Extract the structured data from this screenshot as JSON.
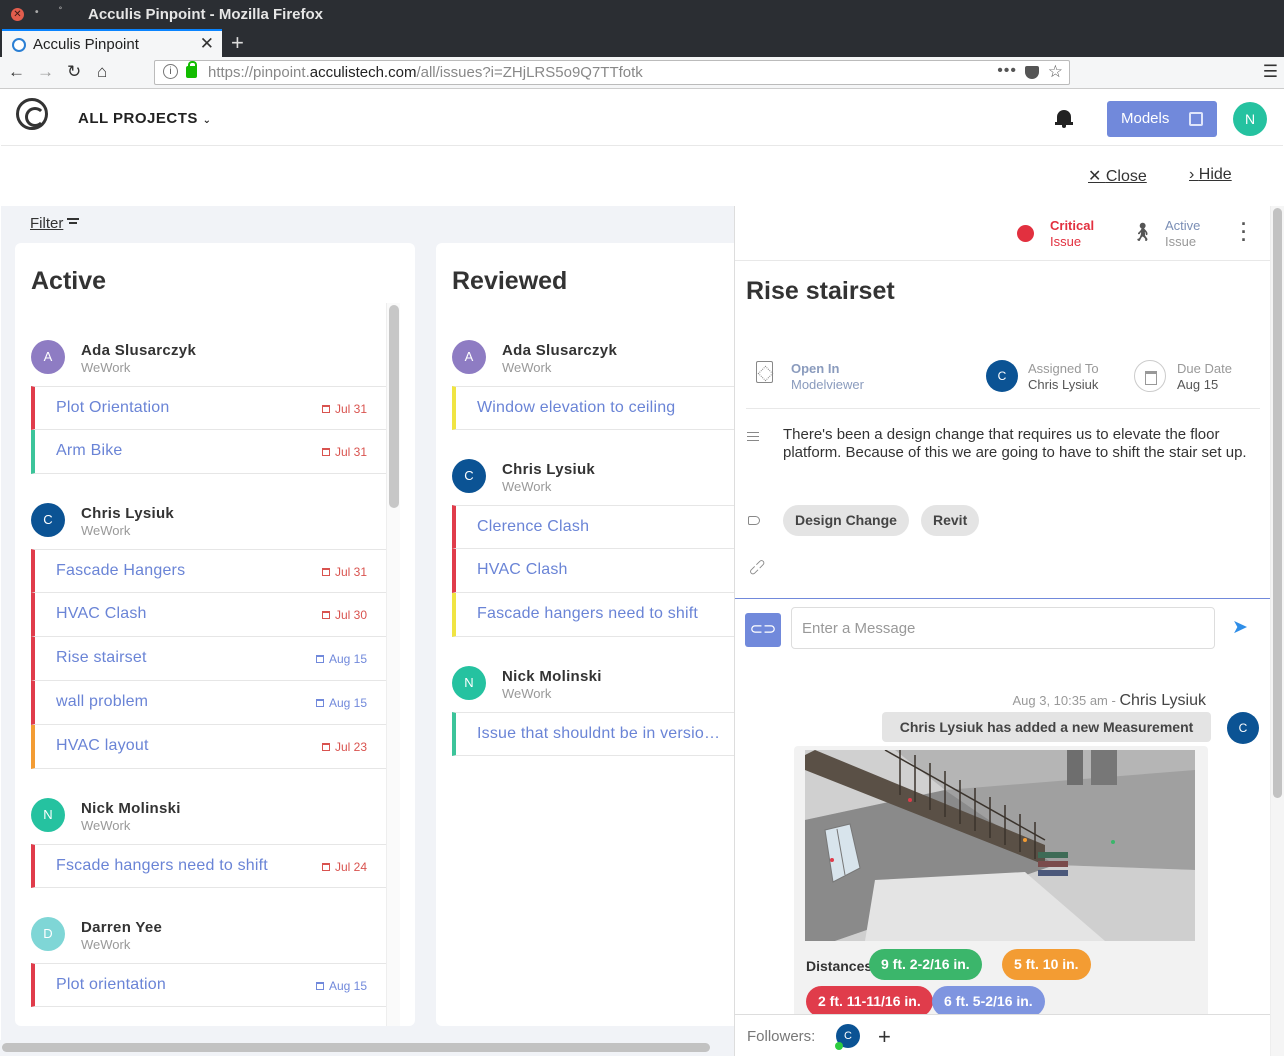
{
  "window": {
    "title": "Acculis Pinpoint - Mozilla Firefox"
  },
  "tab": {
    "title": "Acculis Pinpoint"
  },
  "address": {
    "prefix": "https://pinpoint.",
    "domain": "acculistech.com",
    "path": "/all/issues?i=ZHjLRS5o9Q7TTfotk"
  },
  "header": {
    "projects_label": "ALL PROJECTS",
    "models_label": "Models",
    "user_initial": "N"
  },
  "subheader": {
    "close_label": "Close",
    "hide_label": "Hide"
  },
  "board": {
    "filter_label": "Filter",
    "columns": [
      {
        "title": "Active",
        "groups": [
          {
            "name": "Ada Slusarczyk",
            "org": "WeWork",
            "initial": "A",
            "color": "#8e7cc3",
            "issues": [
              {
                "name": "Plot Orientation",
                "date": "Jul 31",
                "color": "#e03c4b",
                "overdue": true
              },
              {
                "name": "Arm Bike",
                "date": "Jul 31",
                "color": "#3cc49a",
                "overdue": true
              }
            ]
          },
          {
            "name": "Chris Lysiuk",
            "org": "WeWork",
            "initial": "C",
            "color": "#0b5394",
            "issues": [
              {
                "name": "Fascade Hangers",
                "date": "Jul 31",
                "color": "#e03c4b",
                "overdue": true
              },
              {
                "name": "HVAC Clash",
                "date": "Jul 30",
                "color": "#e03c4b",
                "overdue": true
              },
              {
                "name": "Rise stairset",
                "date": "Aug 15",
                "color": "#e03c4b",
                "overdue": false
              },
              {
                "name": "wall problem",
                "date": "Aug 15",
                "color": "#e03c4b",
                "overdue": false
              },
              {
                "name": "HVAC layout",
                "date": "Jul 23",
                "color": "#f39c33",
                "overdue": true
              }
            ]
          },
          {
            "name": "Nick Molinski",
            "org": "WeWork",
            "initial": "N",
            "color": "#25c2a0",
            "issues": [
              {
                "name": "Fscade hangers need to shift",
                "date": "Jul 24",
                "color": "#e03c4b",
                "overdue": true
              }
            ]
          },
          {
            "name": "Darren Yee",
            "org": "WeWork",
            "initial": "D",
            "color": "#7fd6d6",
            "issues": [
              {
                "name": "Plot orientation",
                "date": "Aug 15",
                "color": "#e03c4b",
                "overdue": false
              }
            ]
          }
        ]
      },
      {
        "title": "Reviewed",
        "groups": [
          {
            "name": "Ada Slusarczyk",
            "org": "WeWork",
            "initial": "A",
            "color": "#8e7cc3",
            "issues": [
              {
                "name": "Window elevation to ceiling",
                "date": "",
                "color": "#f0e442"
              }
            ]
          },
          {
            "name": "Chris Lysiuk",
            "org": "WeWork",
            "initial": "C",
            "color": "#0b5394",
            "issues": [
              {
                "name": "Clerence Clash",
                "date": "",
                "color": "#e03c4b"
              },
              {
                "name": "HVAC Clash",
                "date": "",
                "color": "#e03c4b"
              },
              {
                "name": "Fascade hangers need to shift",
                "date": "",
                "color": "#f0e442"
              }
            ]
          },
          {
            "name": "Nick Molinski",
            "org": "WeWork",
            "initial": "N",
            "color": "#25c2a0",
            "issues": [
              {
                "name": "Issue that shouldnt be in versio…",
                "date": "",
                "color": "#3cc49a"
              }
            ]
          }
        ]
      }
    ]
  },
  "detail": {
    "priority_label": "Critical",
    "priority_sub": "Issue",
    "status_label": "Active",
    "status_sub": "Issue",
    "title": "Rise stairset",
    "open_in_label": "Open In",
    "open_in_value": "Modelviewer",
    "assigned_label": "Assigned To",
    "assigned_value": "Chris Lysiuk",
    "assigned_initial": "C",
    "due_label": "Due Date",
    "due_value": "Aug 15",
    "description": "There's been a design change that requires us to elevate the floor platform. Because of this we are going to have to shift the stair set up.",
    "tags": [
      "Design Change",
      "Revit"
    ],
    "message_placeholder": "Enter a Message",
    "chat": {
      "timestamp": "Aug 3, 10:35 am",
      "separator": " - ",
      "author": "Chris Lysiuk",
      "author_initial": "C",
      "text": "Chris Lysiuk has added a new Measurement",
      "distances_label": "Distances:",
      "distances": [
        {
          "value": "9 ft. 2-2/16 in.",
          "color": "#3bb66b"
        },
        {
          "value": "5 ft. 10 in.",
          "color": "#f39c33"
        },
        {
          "value": "2 ft. 11-11/16 in.",
          "color": "#e03c4b"
        },
        {
          "value": "6 ft. 5-2/16 in.",
          "color": "#7f95e0"
        }
      ]
    },
    "followers_label": "Followers:",
    "follower_initial": "C"
  }
}
